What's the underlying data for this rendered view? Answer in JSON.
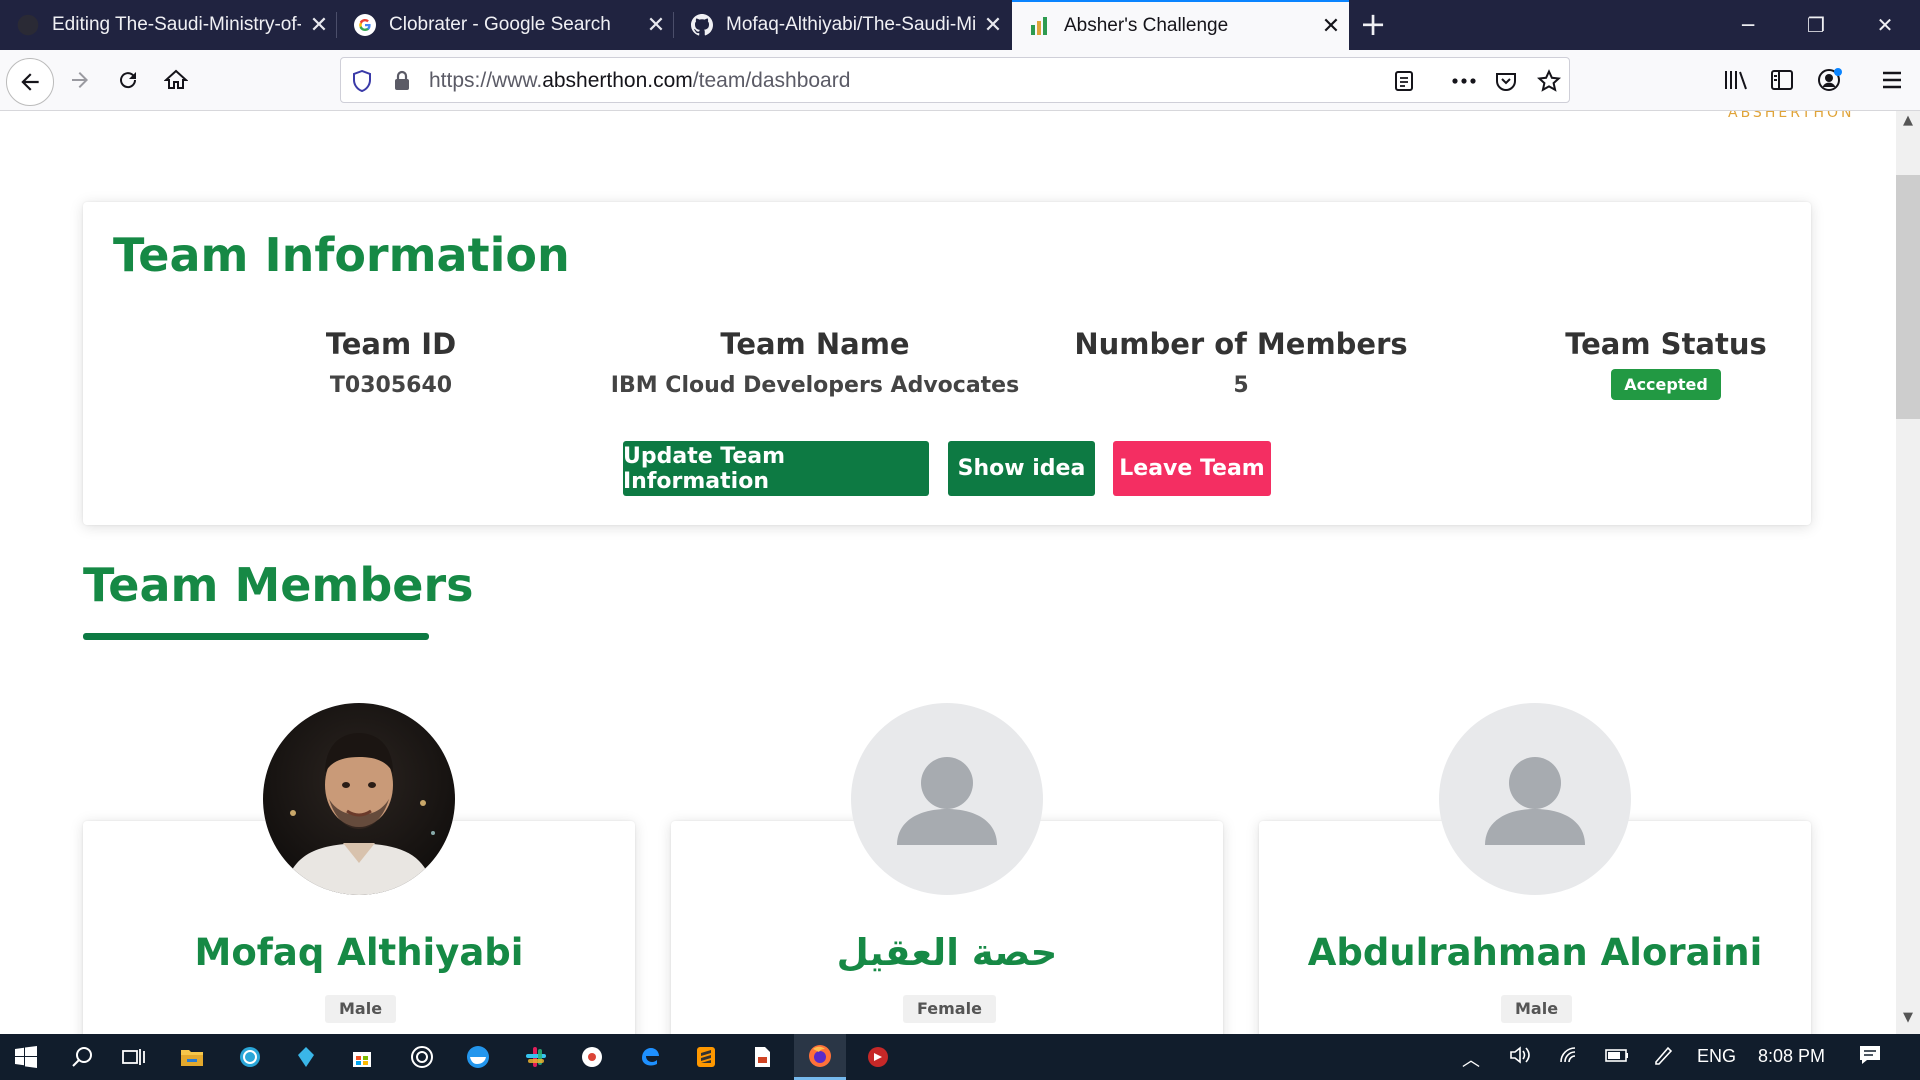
{
  "browser": {
    "tabs": [
      {
        "title": "Editing The-Saudi-Ministry-of-I",
        "icon": "github-icon"
      },
      {
        "title": "Clobrater - Google Search",
        "icon": "google-icon"
      },
      {
        "title": "Mofaq-Althiyabi/The-Saudi-Mi",
        "icon": "github-icon"
      },
      {
        "title": "Absher's Challenge",
        "icon": "absher-icon",
        "active": true
      }
    ],
    "url_prefix": "https://www.",
    "url_domain": "absherthon.com",
    "url_path": "/team/dashboard"
  },
  "page": {
    "logo_peek": "ABSHERTHON",
    "team_info": {
      "title": "Team Information",
      "columns": [
        {
          "label": "Team ID",
          "value": "T0305640"
        },
        {
          "label": "Team Name",
          "value": "IBM Cloud Developers Advocates"
        },
        {
          "label": "Number of Members",
          "value": "5"
        },
        {
          "label": "Team Status",
          "value": "Accepted"
        }
      ],
      "buttons": {
        "update": "Update Team Information",
        "show_idea": "Show idea",
        "leave": "Leave Team"
      },
      "colors": {
        "primary_green": "#168945",
        "button_green": "#0d7a43",
        "danger_pink": "#f42e62",
        "badge_green": "#229943"
      }
    },
    "members": {
      "title": "Team Members",
      "list": [
        {
          "name": "Mofaq Althiyabi",
          "gender": "Male",
          "avatar": "photo"
        },
        {
          "name": "حصة العقيل",
          "gender": "Female",
          "avatar": "default-user-icon"
        },
        {
          "name": "Abdulrahman Aloraini",
          "gender": "Male",
          "avatar": "default-user-icon"
        }
      ]
    }
  },
  "taskbar": {
    "language": "ENG",
    "time": "8:08 PM"
  }
}
